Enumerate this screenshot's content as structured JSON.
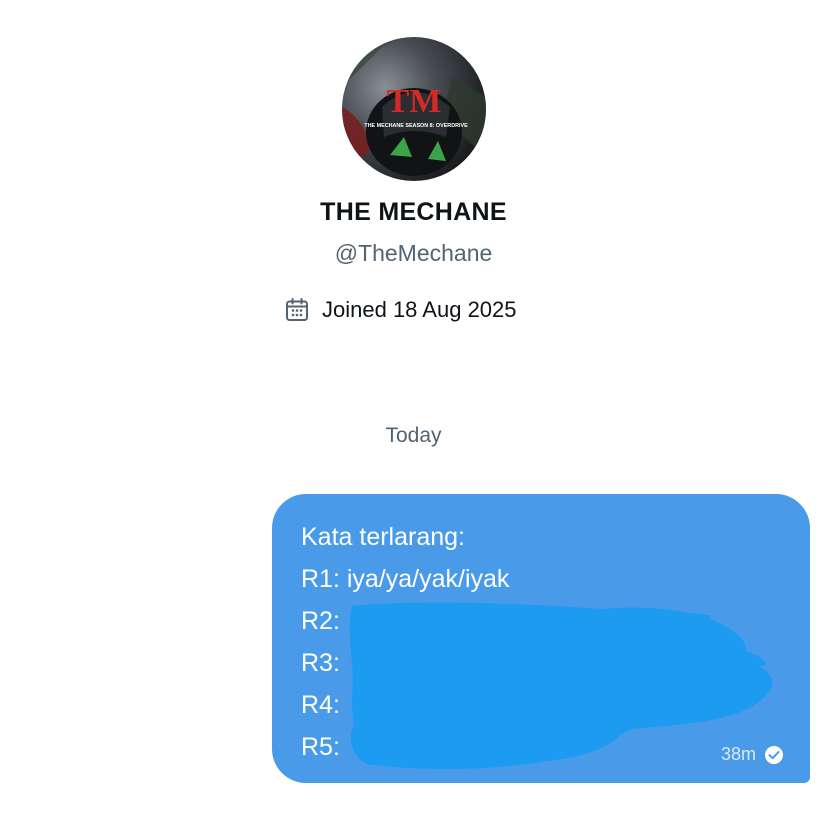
{
  "profile": {
    "avatar_logo_text": "TM",
    "avatar_caption": "THE MECHANE SEASON 8: OVERDRIVE",
    "name": "THE MECHANE",
    "handle": "@TheMechane",
    "joined": "Joined 18 Aug 2025"
  },
  "conversation": {
    "day_separator": "Today",
    "message": {
      "lines": [
        "Kata terlarang:",
        "R1: iya/ya/yak/iyak",
        "R2:",
        "R3:",
        "R4:",
        "R5:"
      ],
      "time": "38m",
      "status_icon": "read-check-icon"
    }
  },
  "colors": {
    "bubble": "#4a9aea",
    "scribble": "#1d9bf0",
    "secondary_text": "#536471",
    "primary_text": "#0f1419",
    "logo_red": "#d32a2a"
  }
}
